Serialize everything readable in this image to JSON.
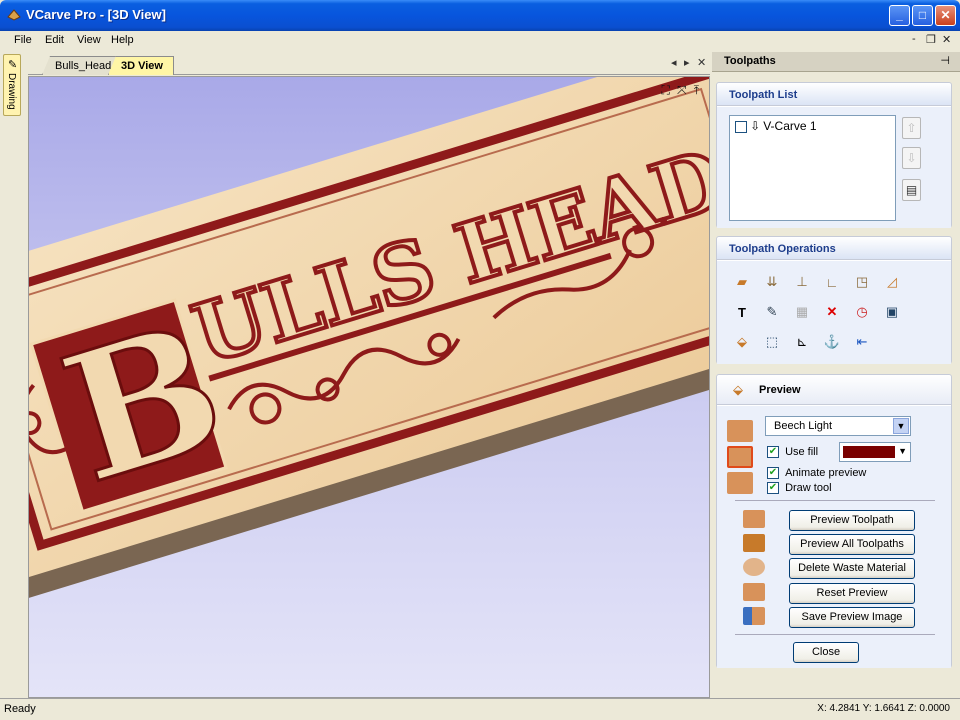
{
  "window": {
    "title": "VCarve Pro - [3D View]",
    "minimize": "_",
    "maximize": "□",
    "close": "✕"
  },
  "menu": {
    "items": [
      "File",
      "Edit",
      "View",
      "Help"
    ],
    "mdi_minimize": "-",
    "mdi_restore": "❐",
    "mdi_close": "✕"
  },
  "left_tab": {
    "label": "Drawing"
  },
  "doc_tabs": {
    "tabs": [
      "Bulls_Head",
      "3D View"
    ],
    "active": "3D View",
    "prev": "◂",
    "next": "▸",
    "close": "✕"
  },
  "view": {
    "carving_text": "BULLS HEAD",
    "icons": [
      "fit-view-icon",
      "iso-view-icon",
      "top-view-icon"
    ]
  },
  "panel": {
    "title": "Toolpaths",
    "pin": "⊣",
    "list_section": {
      "title": "Toolpath List",
      "items": [
        {
          "name": "V-Carve 1",
          "checked": false
        }
      ]
    },
    "ops_section": {
      "title": "Toolpath Operations"
    },
    "preview_section": {
      "title": "Preview",
      "material": "Beech Light",
      "use_fill_label": "Use fill",
      "use_fill_checked": true,
      "fill_color": "#7a0000",
      "animate_label": "Animate preview",
      "animate_checked": true,
      "draw_tool_label": "Draw tool",
      "draw_tool_checked": true,
      "buttons": {
        "preview_toolpath": "Preview Toolpath",
        "preview_all": "Preview All Toolpaths",
        "delete_waste": "Delete Waste Material",
        "reset_preview": "Reset Preview",
        "save_image": "Save Preview Image"
      },
      "close": "Close"
    }
  },
  "status": {
    "left": "Ready",
    "coords": "X: 4.2841 Y: 1.6641 Z: 0.0000"
  },
  "colors": {
    "wood": "#f2d9b0",
    "carve": "#8e1a1a",
    "sky": "#c9c9f0"
  }
}
